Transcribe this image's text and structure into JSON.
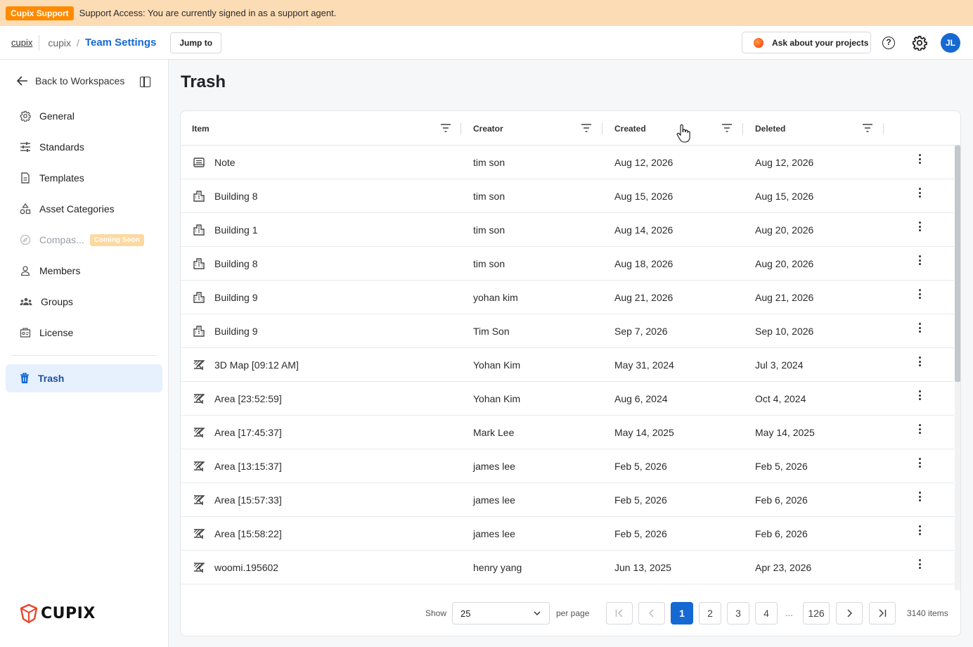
{
  "banner": {
    "tag": "Cupix Support",
    "text": "Support Access: You are currently signed in as a support agent."
  },
  "topbar": {
    "brand": "cupix",
    "crumb_parent": "cupix",
    "crumb_sep": "/",
    "crumb_current": "Team Settings",
    "jump_label": "Jump to",
    "ask_label": "Ask about your projects",
    "help_glyph": "?",
    "avatar_initials": "JL"
  },
  "sidebar": {
    "back_label": "Back to Workspaces",
    "items": [
      {
        "label": "General",
        "icon": "gear-icon"
      },
      {
        "label": "Standards",
        "icon": "sliders-icon"
      },
      {
        "label": "Templates",
        "icon": "document-icon"
      },
      {
        "label": "Asset Categories",
        "icon": "shapes-icon"
      },
      {
        "label": "Compas...",
        "icon": "compass-icon",
        "badge": "Coming Soon",
        "disabled": true
      },
      {
        "label": "Members",
        "icon": "person-icon"
      },
      {
        "label": "Groups",
        "icon": "group-icon"
      },
      {
        "label": "License",
        "icon": "license-icon"
      },
      {
        "label": "Trash",
        "icon": "trash-icon",
        "active": true
      }
    ],
    "logo_text": "CUPIX"
  },
  "main": {
    "title": "Trash",
    "columns": [
      "Item",
      "Creator",
      "Created",
      "Deleted"
    ],
    "rows": [
      {
        "icon": "note-icon",
        "item": "Note",
        "creator": "tim son",
        "created": "Aug 12, 2026",
        "deleted": "Aug 12, 2026"
      },
      {
        "icon": "building-icon",
        "item": "Building 8",
        "creator": "tim son",
        "created": "Aug 15, 2026",
        "deleted": "Aug 15, 2026"
      },
      {
        "icon": "building-icon",
        "item": "Building 1",
        "creator": "tim son",
        "created": "Aug 14, 2026",
        "deleted": "Aug 20, 2026"
      },
      {
        "icon": "building-icon",
        "item": "Building 8",
        "creator": "tim son",
        "created": "Aug 18, 2026",
        "deleted": "Aug 20, 2026"
      },
      {
        "icon": "building-icon",
        "item": "Building 9",
        "creator": "yohan kim",
        "created": "Aug 21, 2026",
        "deleted": "Aug 21, 2026"
      },
      {
        "icon": "building-icon",
        "item": "Building 9",
        "creator": "Tim Son",
        "created": "Sep 7, 2026",
        "deleted": "Sep 10, 2026"
      },
      {
        "icon": "area-icon",
        "item": "3D Map [09:12 AM]",
        "creator": "Yohan Kim",
        "created": "May 31, 2024",
        "deleted": "Jul 3, 2024"
      },
      {
        "icon": "area-icon",
        "item": "Area [23:52:59]",
        "creator": "Yohan Kim",
        "created": "Aug 6, 2024",
        "deleted": "Oct 4, 2024"
      },
      {
        "icon": "area-icon",
        "item": "Area [17:45:37]",
        "creator": "Mark Lee",
        "created": "May 14, 2025",
        "deleted": "May 14, 2025"
      },
      {
        "icon": "area-icon",
        "item": "Area [13:15:37]",
        "creator": "james lee",
        "created": "Feb 5, 2026",
        "deleted": "Feb 5, 2026"
      },
      {
        "icon": "area-icon",
        "item": "Area [15:57:33]",
        "creator": "james lee",
        "created": "Feb 5, 2026",
        "deleted": "Feb 6, 2026"
      },
      {
        "icon": "area-icon",
        "item": "Area [15:58:22]",
        "creator": "james lee",
        "created": "Feb 5, 2026",
        "deleted": "Feb 6, 2026"
      },
      {
        "icon": "area-icon",
        "item": "woomi.195602",
        "creator": "henry yang",
        "created": "Jun 13, 2025",
        "deleted": "Apr 23, 2026"
      }
    ]
  },
  "pagination": {
    "show_label": "Show",
    "per_page_value": "25",
    "per_page_label": "per page",
    "pages": [
      "1",
      "2",
      "3",
      "4"
    ],
    "current_page": "1",
    "ellipsis": "...",
    "last_page": "126",
    "total_label": "3140 items"
  },
  "colors": {
    "accent": "#1669d3",
    "banner": "#fcdcb5",
    "support_tag": "#ff8a00",
    "coming_soon": "#fdd9a0"
  }
}
